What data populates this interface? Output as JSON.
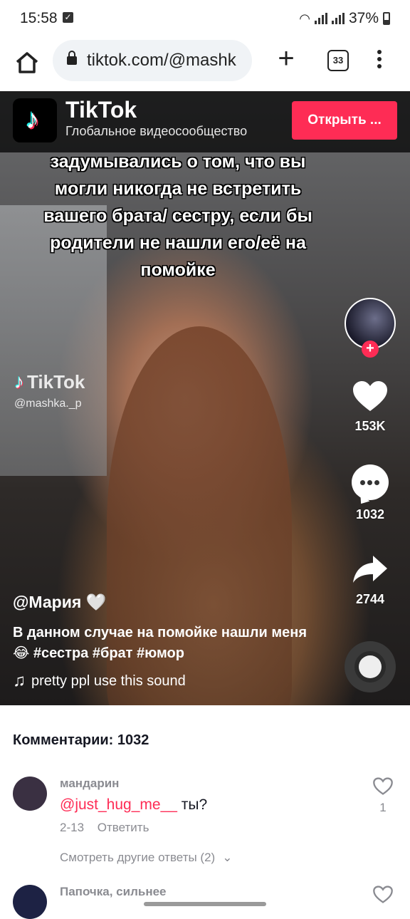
{
  "status_bar": {
    "time": "15:58",
    "battery": "37%"
  },
  "browser": {
    "url": "tiktok.com/@mashk",
    "tab_count": "33"
  },
  "banner": {
    "app_name": "TikTok",
    "tagline": "Глобальное видеосообщество",
    "open_label": "Открыть ..."
  },
  "video": {
    "overlay_text": "задумывались о том, что вы могли никогда не встретить вашего брата/ сестру, если бы родители не нашли его/её на помойке",
    "watermark_logo": "TikTok",
    "watermark_handle": "@mashka._p",
    "likes": "153K",
    "comments": "1032",
    "shares": "2744",
    "author": "@Мария 🤍",
    "description": "В данном случае на помойке нашли меня 😂 #сестра #брат #юмор",
    "sound": "pretty ppl use this sound"
  },
  "comments_section": {
    "count_label": "Комментарии: 1032",
    "items": [
      {
        "user": "мандарин",
        "mention": "@just_hug_me__",
        "text": " ты?",
        "date": "2-13",
        "reply_label": "Ответить",
        "more_replies": "Смотреть другие ответы (2)",
        "likes": "1",
        "avatar_color": "#3a3042"
      },
      {
        "user": "Папочка, сильнее",
        "avatar_color": "#1d2244"
      }
    ]
  },
  "colors": {
    "accent": "#fe2c55",
    "muted": "#8a8b91"
  },
  "icons": [
    "home-icon",
    "lock-icon",
    "plus-icon",
    "tabs-icon",
    "more-vert-icon",
    "heart-icon",
    "comment-icon",
    "share-icon",
    "music-note-icon",
    "chevron-down-icon"
  ]
}
